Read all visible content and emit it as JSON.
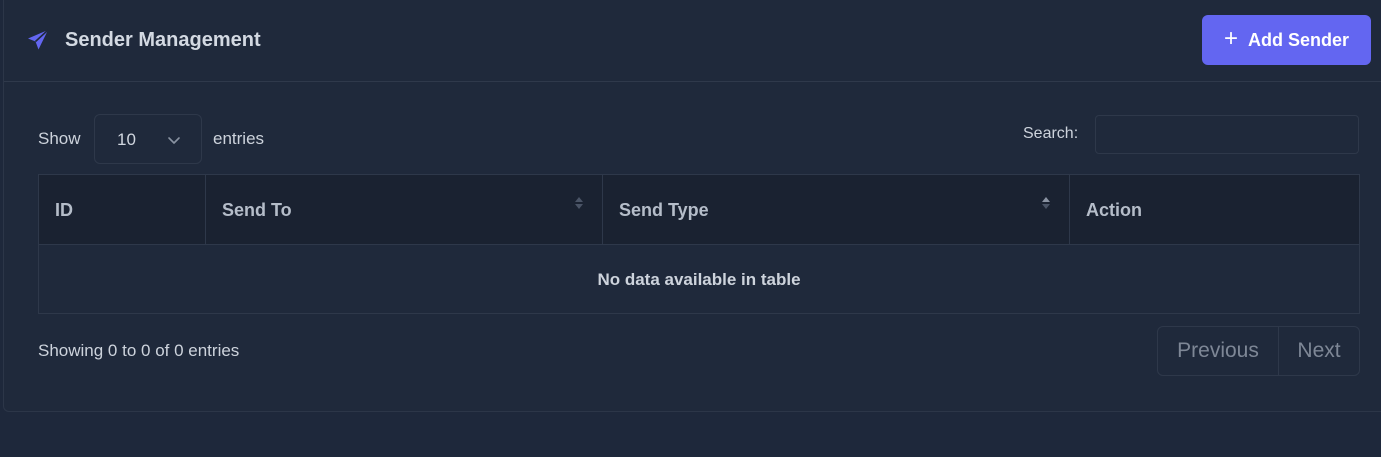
{
  "header": {
    "title": "Sender Management",
    "icon": "paper-plane-icon",
    "add_button_label": "Add Sender",
    "add_button_icon": "plus-icon",
    "accent_color": "#6366f1"
  },
  "controls": {
    "show_label": "Show",
    "page_length": "10",
    "entries_label": "entries",
    "search_label": "Search:",
    "search_value": ""
  },
  "table": {
    "columns": [
      {
        "label": "ID",
        "sortable": false
      },
      {
        "label": "Send To",
        "sortable": true
      },
      {
        "label": "Send Type",
        "sortable": true
      },
      {
        "label": "Action",
        "sortable": false
      }
    ],
    "empty_message": "No data available in table"
  },
  "footer": {
    "info": "Showing 0 to 0 of 0 entries",
    "previous_label": "Previous",
    "next_label": "Next"
  }
}
